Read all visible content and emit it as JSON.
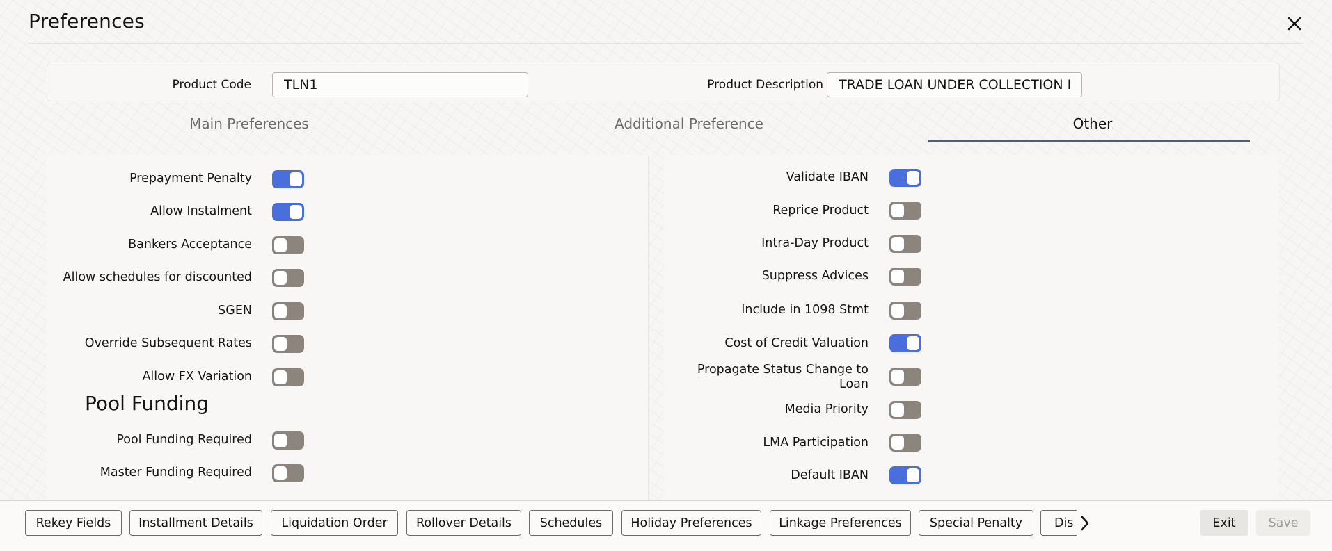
{
  "window": {
    "title": "Preferences"
  },
  "header": {
    "product_code_label": "Product Code",
    "product_code_value": "TLN1",
    "product_description_label": "Product Description",
    "product_description_value": "TRADE LOAN UNDER COLLECTION I"
  },
  "tabs": [
    {
      "label": "Main Preferences",
      "active": false
    },
    {
      "label": "Additional Preference",
      "active": false
    },
    {
      "label": "Other",
      "active": true
    }
  ],
  "left_section": {
    "toggles": [
      {
        "label": "Prepayment Penalty",
        "on": true
      },
      {
        "label": "Allow Instalment",
        "on": true
      },
      {
        "label": "Bankers Acceptance",
        "on": false
      },
      {
        "label": "Allow schedules for discounted",
        "on": false
      },
      {
        "label": "SGEN",
        "on": false
      },
      {
        "label": "Override Subsequent Rates",
        "on": false
      },
      {
        "label": "Allow FX Variation",
        "on": false
      }
    ],
    "pool_funding": {
      "heading": "Pool Funding",
      "toggles": [
        {
          "label": "Pool Funding Required",
          "on": false
        },
        {
          "label": "Master Funding Required",
          "on": false
        }
      ]
    }
  },
  "right_section": {
    "toggles": [
      {
        "label": "Validate IBAN",
        "on": true
      },
      {
        "label": "Reprice Product",
        "on": false
      },
      {
        "label": "Intra-Day Product",
        "on": false
      },
      {
        "label": "Suppress Advices",
        "on": false
      },
      {
        "label": "Include in 1098 Stmt",
        "on": false
      },
      {
        "label": "Cost of Credit Valuation",
        "on": true
      },
      {
        "label_line1": "Propagate Status Change to",
        "label_line2": "Loan",
        "on": false
      },
      {
        "label": "Media Priority",
        "on": false
      },
      {
        "label": "LMA Participation",
        "on": false
      },
      {
        "label": "Default IBAN",
        "on": true
      }
    ]
  },
  "footer": {
    "buttons": [
      "Rekey Fields",
      "Installment Details",
      "Liquidation Order",
      "Rollover Details",
      "Schedules",
      "Holiday Preferences",
      "Linkage Preferences",
      "Special Penalty",
      "Dis"
    ],
    "exit_label": "Exit",
    "save_label": "Save"
  },
  "icons": {
    "close": "close-icon",
    "scroll_right": "chevron-right-icon"
  },
  "colors": {
    "toggle_on": "#4a6fdc",
    "toggle_off": "#8c857e",
    "tab_underline": "#525c6e"
  }
}
